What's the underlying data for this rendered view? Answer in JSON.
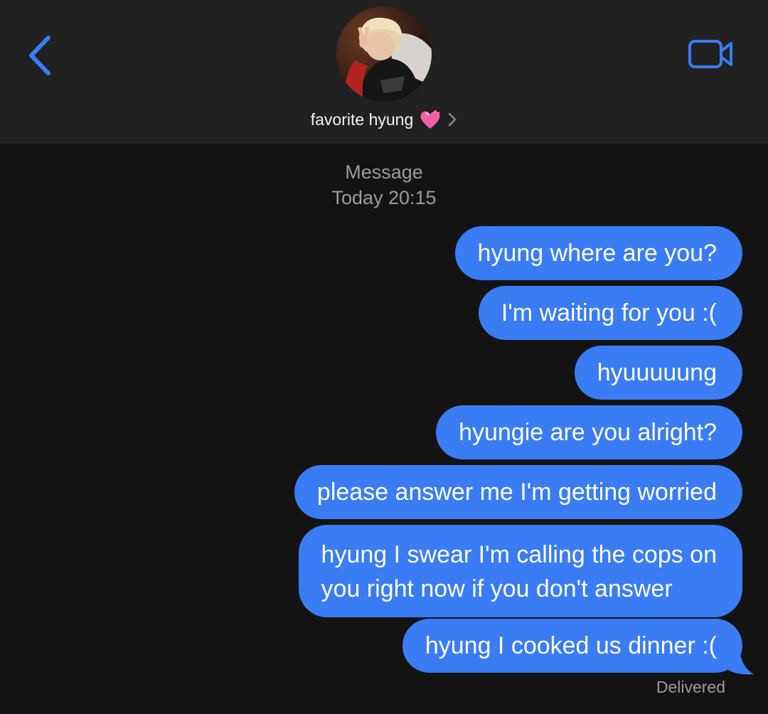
{
  "header": {
    "contact_name": "favorite hyung",
    "icons": {
      "back": "chevron-left-icon",
      "video": "video-camera-icon",
      "heart": "heart-emoji",
      "disclosure": "chevron-right-icon"
    },
    "avatar": "contact-photo"
  },
  "conversation": {
    "service_label": "Message",
    "timestamp": "Today 20:15",
    "messages": [
      {
        "text": "hyung where are you?"
      },
      {
        "text": "I'm waiting for you :("
      },
      {
        "text": "hyuuuuung"
      },
      {
        "text": "hyungie are you alright?"
      },
      {
        "text": "please answer me I'm getting worried"
      },
      {
        "line1": "hyung I swear I'm calling the cops on",
        "line2": "you right now if you don't answer"
      },
      {
        "text": "hyung I cooked us dinner :("
      }
    ],
    "status": "Delivered"
  },
  "colors": {
    "accent": "#3a7cf4",
    "header_bg": "#212121",
    "background": "#131313",
    "meta_text": "#9c9c9c"
  }
}
